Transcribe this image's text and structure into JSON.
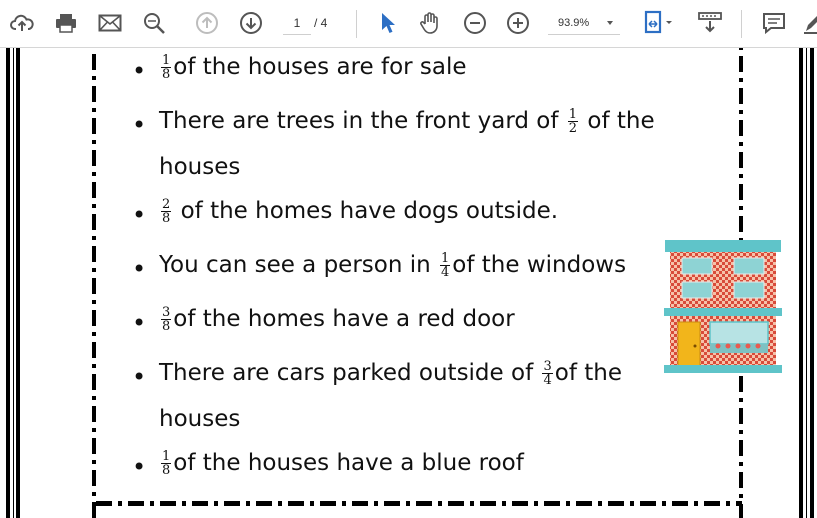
{
  "toolbar": {
    "page_current": "1",
    "page_total": "/ 4",
    "zoom": "93.9%",
    "icons": [
      "cloud-upload-icon",
      "print-icon",
      "mail-icon",
      "zoom-search-icon",
      "prev-page-icon",
      "next-page-icon",
      "select-cursor-icon",
      "hand-tool-icon",
      "zoom-out-icon",
      "zoom-in-icon",
      "fit-page-icon",
      "scroll-mode-icon",
      "comment-icon",
      "pen-icon"
    ]
  },
  "document": {
    "items": [
      {
        "pre": "",
        "num": "1",
        "den": "8",
        "post": "of the houses are for sale"
      },
      {
        "pre": "There are trees in the front yard of ",
        "num": "1",
        "den": "2",
        "post": " of the"
      },
      {
        "cont": "houses"
      },
      {
        "pre": "",
        "num": "2",
        "den": "8",
        "post": " of the homes have dogs outside."
      },
      {
        "pre": "You can see a person in ",
        "num": "1",
        "den": "4",
        "post": "of the windows"
      },
      {
        "pre": "",
        "num": "3",
        "den": "8",
        "post": "of the homes have a red door"
      },
      {
        "pre": "There are cars parked outside of ",
        "num": "3",
        "den": "4",
        "post": "of the"
      },
      {
        "cont": "houses"
      },
      {
        "pre": "",
        "num": "1",
        "den": "8",
        "post": "of the houses have a blue roof"
      }
    ],
    "colors": {
      "roof": "#5fc4c9",
      "brick": "#d84b3a",
      "door": "#f2b51b",
      "window": "#8ed3d4"
    }
  }
}
